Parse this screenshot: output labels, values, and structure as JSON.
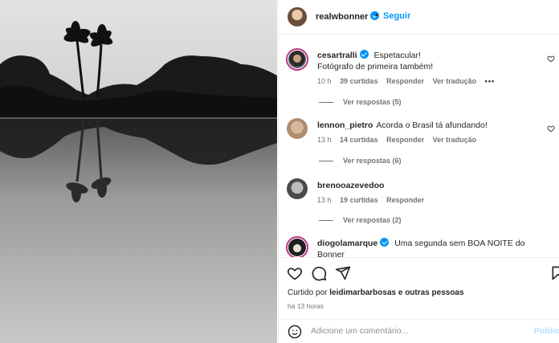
{
  "post": {
    "author": "realwbonner",
    "follow_label": "Seguir",
    "dot": "•"
  },
  "comments": [
    {
      "user": "cesartralli",
      "text_line1": "Espetacular!",
      "text_line2": "Fotógrafo de primeira também!",
      "time": "10 h",
      "likes": "39 curtidas",
      "reply_label": "Responder",
      "translate_label": "Ver tradução",
      "more": "•••",
      "view_replies": "Ver respostas (5)"
    },
    {
      "user": "lennon_pietro",
      "text_line1": "Acorda o Brasil tá afundando!",
      "time": "13 h",
      "likes": "14 curtidas",
      "reply_label": "Responder",
      "translate_label": "Ver tradução",
      "view_replies": "Ver respostas (6)"
    },
    {
      "user": "brenooazevedoo",
      "time": "13 h",
      "likes": "19 curtidas",
      "reply_label": "Responder",
      "view_replies": "Ver respostas (2)"
    },
    {
      "user": "diogolamarque",
      "text_line1": "Uma segunda sem BOA NOITE do Bonner"
    }
  ],
  "footer": {
    "liked_prefix": "Curtido por",
    "liked_user": "leidimarbarbosas",
    "liked_mid": "e",
    "liked_others": "outras pessoas",
    "time_ago": "há 13 horas",
    "comment_placeholder": "Adicione um comentário...",
    "publish_label": "Publica"
  },
  "icons": {
    "like": "heart-icon",
    "comment": "comment-icon",
    "share": "share-icon",
    "save": "bookmark-icon",
    "emoji": "emoji-icon",
    "verified": "verified-badge-icon"
  },
  "colors": {
    "accent": "#0095f6",
    "secondary_text": "#737373",
    "publish_disabled": "#b2dffc"
  }
}
